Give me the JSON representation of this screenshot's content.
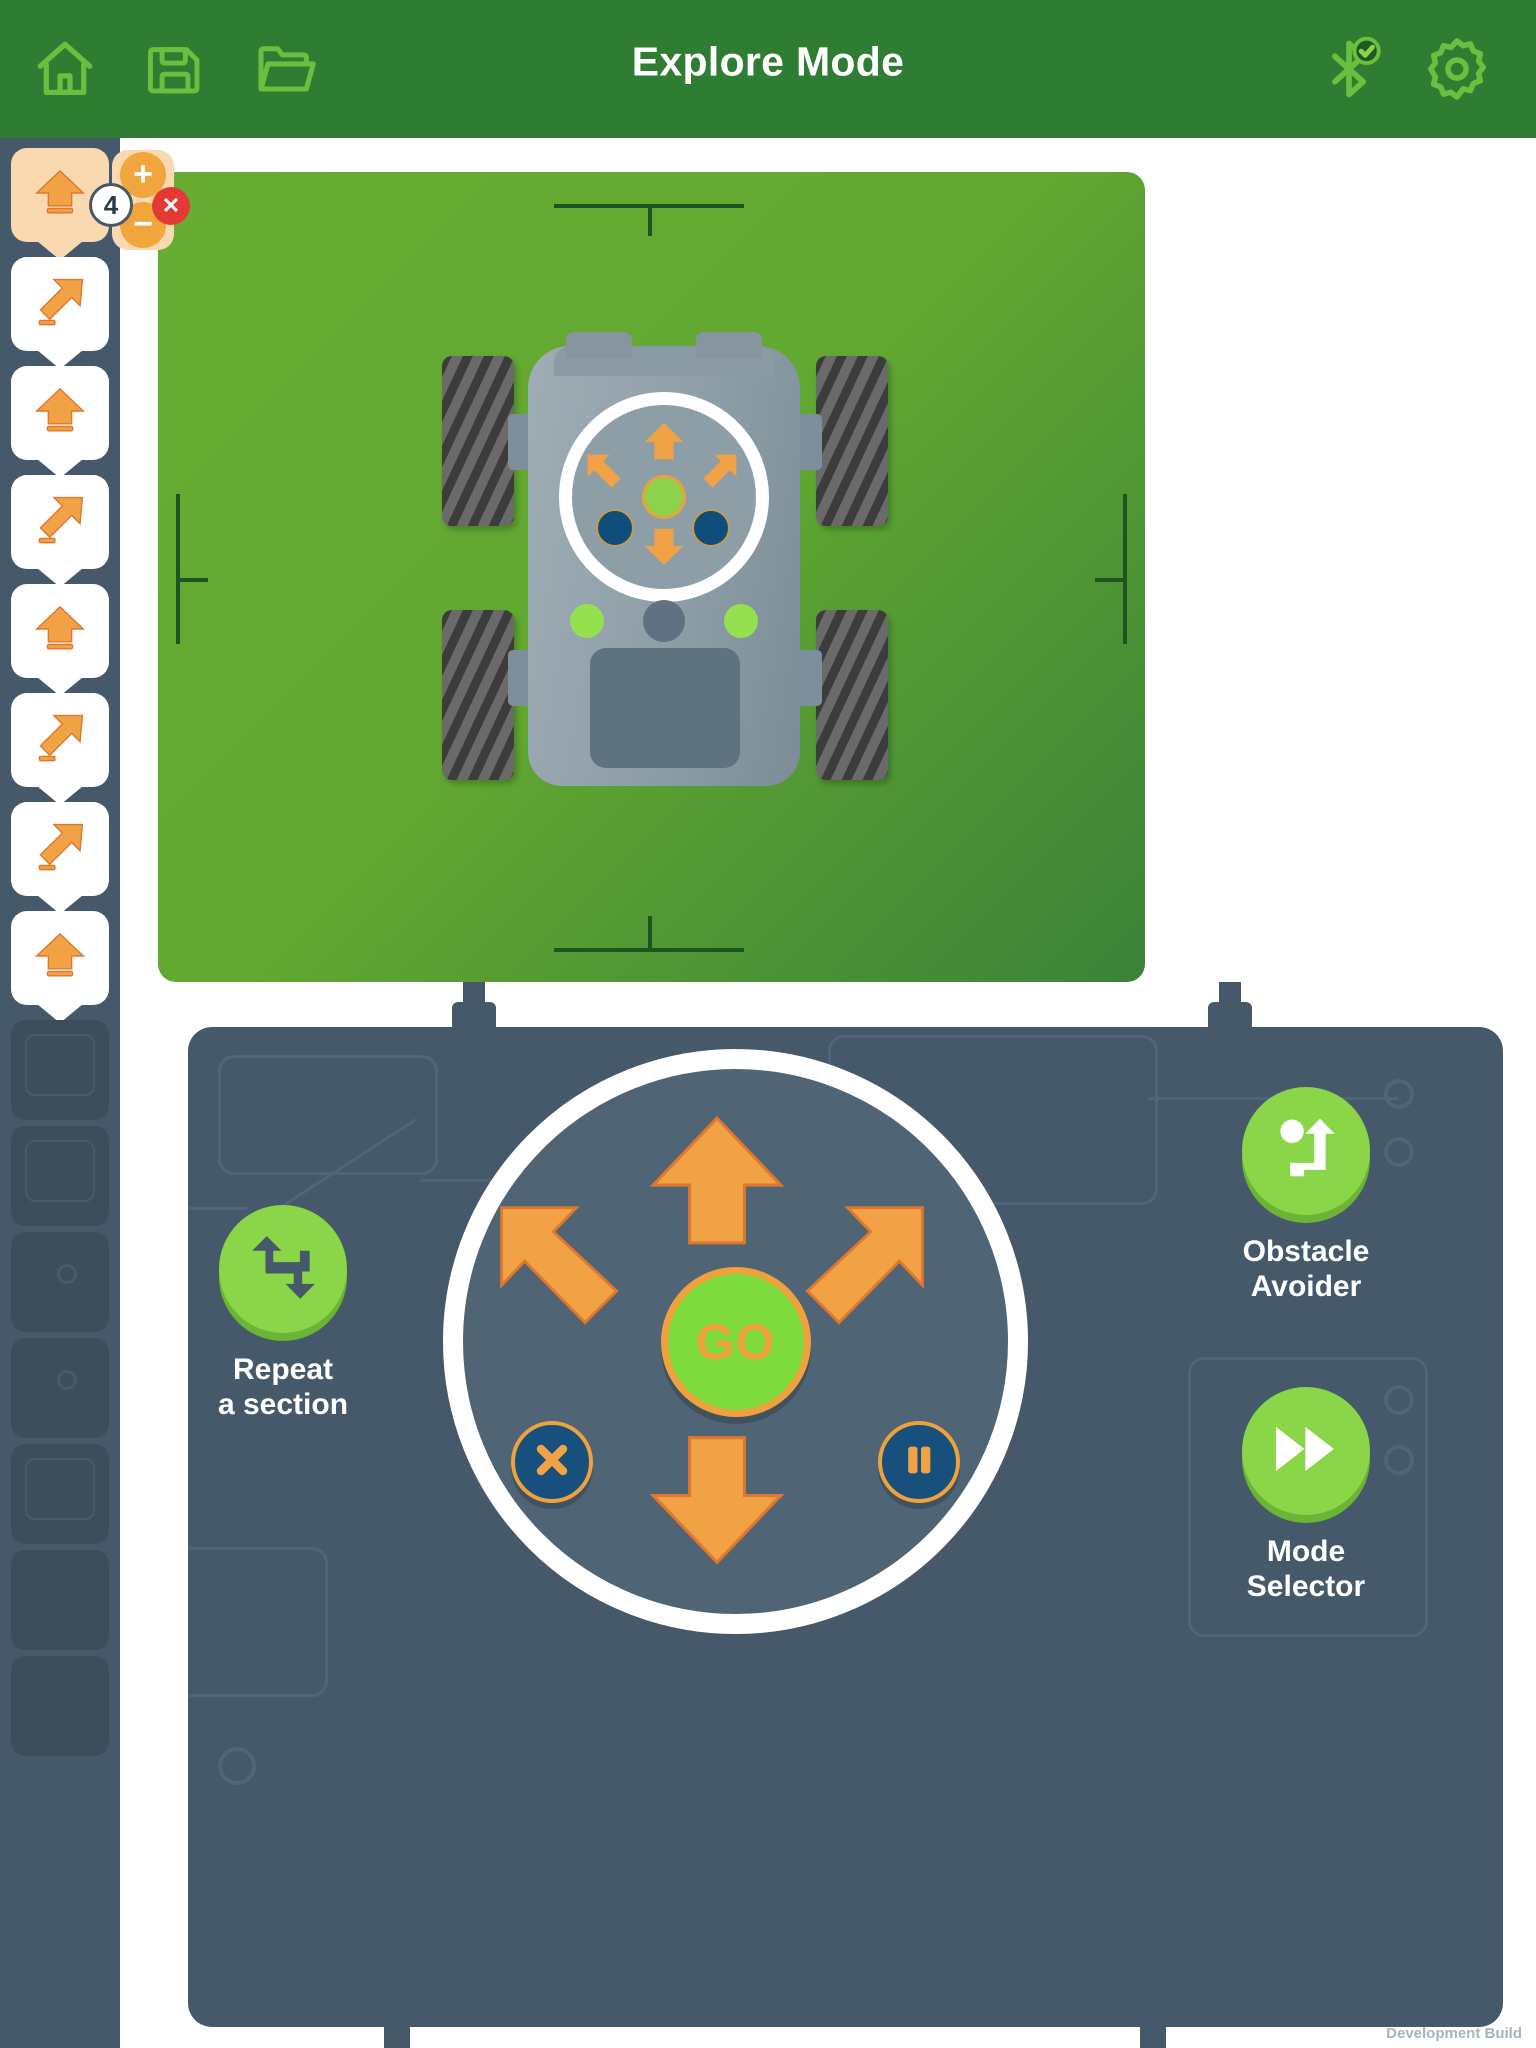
{
  "header": {
    "title": "Explore Mode",
    "left_icons": [
      {
        "name": "home-icon",
        "label": "Home"
      },
      {
        "name": "save-icon",
        "label": "Save"
      },
      {
        "name": "open-folder-icon",
        "label": "Open"
      }
    ],
    "right_icons": [
      {
        "name": "bluetooth-connected-icon",
        "label": "Bluetooth Connected"
      },
      {
        "name": "settings-gear-icon",
        "label": "Settings"
      }
    ],
    "bar_color": "#2e7d32",
    "icon_color": "#6abf3f",
    "title_color": "#ffffff"
  },
  "sidebar": {
    "background": "#46596a",
    "selected_index": 0,
    "blocks": [
      {
        "icon": "arrow-up-icon",
        "direction": "up",
        "selected": true
      },
      {
        "icon": "arrow-up-right-icon",
        "direction": "up-right",
        "selected": false
      },
      {
        "icon": "arrow-up-icon",
        "direction": "up",
        "selected": false
      },
      {
        "icon": "arrow-up-right-icon",
        "direction": "up-right",
        "selected": false
      },
      {
        "icon": "arrow-up-icon",
        "direction": "up",
        "selected": false
      },
      {
        "icon": "arrow-up-right-icon",
        "direction": "up-right",
        "selected": false
      },
      {
        "icon": "arrow-up-right-icon",
        "direction": "up-right",
        "selected": false
      },
      {
        "icon": "arrow-up-icon",
        "direction": "up",
        "selected": false
      }
    ],
    "empty_slot_count": 7,
    "block_fill_color": "#ffffff",
    "block_selected_color": "#fad9b0",
    "arrow_color": "#f0a244"
  },
  "block_editor": {
    "repeat_count": "4",
    "increase_label": "+",
    "decrease_label": "−",
    "delete_label": "✕",
    "stepper_bg": "#fad9b0",
    "stepper_button_color": "#f0a63c",
    "delete_color": "#e53935"
  },
  "arena": {
    "name": "robot-arena",
    "grass_color": "#61a731",
    "marker_color": "#1e5420",
    "robot": {
      "name": "robot-top-view",
      "body_color": "#8e9ea7",
      "tire_color": "#555555",
      "led_color": "#95e04e",
      "pad_center_color": "#8ed14a",
      "pad_arrow_color": "#f0a244",
      "pad_dot_color": "#0e4e78"
    }
  },
  "control_panel": {
    "background": "#46596a",
    "dpad": {
      "name": "direction-pad",
      "ring_color": "#ffffff",
      "face_color": "#4f6474",
      "arrows": [
        {
          "name": "dpad-up-button",
          "direction": "up"
        },
        {
          "name": "dpad-up-left-button",
          "direction": "up-left"
        },
        {
          "name": "dpad-up-right-button",
          "direction": "up-right"
        },
        {
          "name": "dpad-down-button",
          "direction": "down"
        }
      ],
      "go_label": "GO",
      "go_text_color": "#efa23c",
      "go_fill_color": "#7ddb3c",
      "stop_icon": "close-x-icon",
      "pause_icon": "pause-icon",
      "control_fill_color": "#17507c",
      "control_border_color": "#efa23c"
    },
    "actions": [
      {
        "name": "repeat-a-section-button",
        "label": "Repeat\na section",
        "icon": "repeat-loop-icon",
        "position": "left",
        "color": "#8ad548"
      },
      {
        "name": "obstacle-avoider-button",
        "label": "Obstacle\nAvoider",
        "icon": "obstacle-avoider-icon",
        "position": "right-top",
        "color": "#8ad548"
      },
      {
        "name": "mode-selector-button",
        "label": "Mode\nSelector",
        "icon": "fast-forward-icon",
        "position": "right-bottom",
        "color": "#8ad548"
      }
    ]
  },
  "watermark": {
    "text": "Development Build"
  }
}
